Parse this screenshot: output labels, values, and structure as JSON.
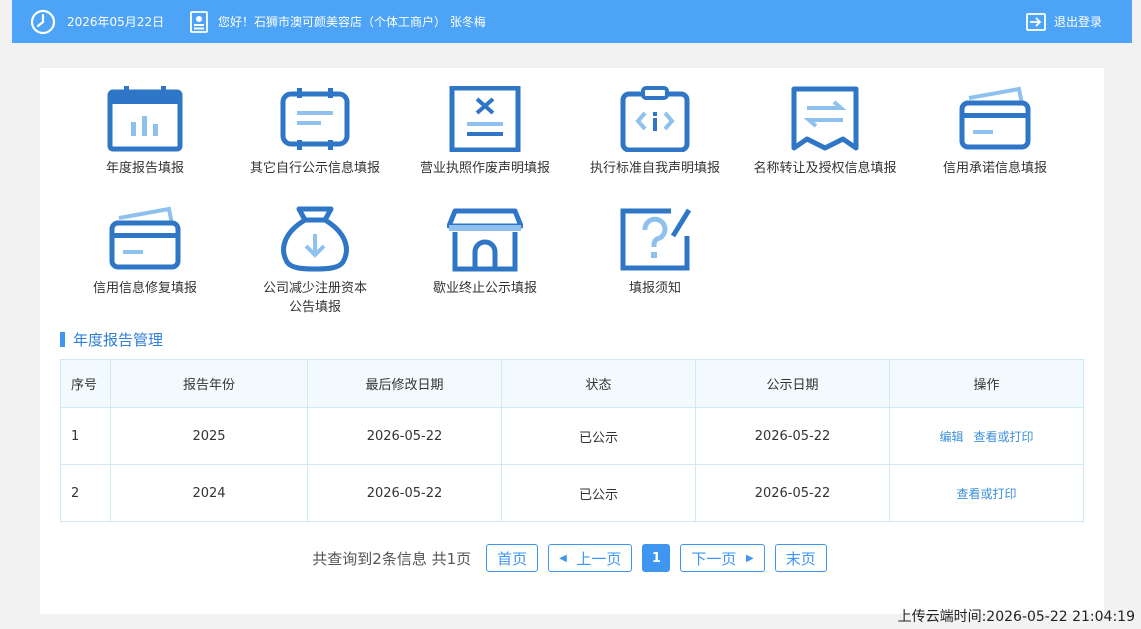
{
  "header": {
    "date": "2026年05月22日",
    "greeting": "您好！石狮市澳可颜美容店（个体工商户） 张冬梅",
    "logout_label": "退出登录",
    "bg_color": "#4da3f5"
  },
  "tiles": [
    {
      "label": "年度报告填报",
      "icon": "calendar-chart-icon"
    },
    {
      "label": "其它自行公示信息填报",
      "icon": "message-board-icon"
    },
    {
      "label": "营业执照作废声明填报",
      "icon": "void-document-icon"
    },
    {
      "label": "执行标准自我声明填报",
      "icon": "clipboard-code-icon"
    },
    {
      "label": "名称转让及授权信息填报",
      "icon": "transfer-receipt-icon"
    },
    {
      "label": "信用承诺信息填报",
      "icon": "credit-card-icon"
    },
    {
      "label": "信用信息修复填报",
      "icon": "credit-card-repair-icon"
    },
    {
      "label": "公司减少注册资本\n公告填报",
      "icon": "money-bag-down-icon"
    },
    {
      "label": "歇业终止公示填报",
      "icon": "storefront-icon"
    },
    {
      "label": "填报须知",
      "icon": "question-note-icon"
    }
  ],
  "section": {
    "title": "年度报告管理"
  },
  "table": {
    "headers": [
      "序号",
      "报告年份",
      "最后修改日期",
      "状态",
      "公示日期",
      "操作"
    ],
    "rows": [
      {
        "idx": "1",
        "year": "2025",
        "modified": "2026-05-22",
        "status": "已公示",
        "published": "2026-05-22",
        "ops": [
          "编辑",
          "查看或打印"
        ]
      },
      {
        "idx": "2",
        "year": "2024",
        "modified": "2026-05-22",
        "status": "已公示",
        "published": "2026-05-22",
        "ops": [
          "查看或打印"
        ]
      }
    ]
  },
  "pager": {
    "info": "共查询到2条信息 共1页",
    "first": "首页",
    "prev": "上一页",
    "current": "1",
    "next": "下一页",
    "last": "末页",
    "accent": "#3e96f0"
  },
  "footer": {
    "upload_time": "上传云端时间:2026-05-22 21:04:19"
  }
}
